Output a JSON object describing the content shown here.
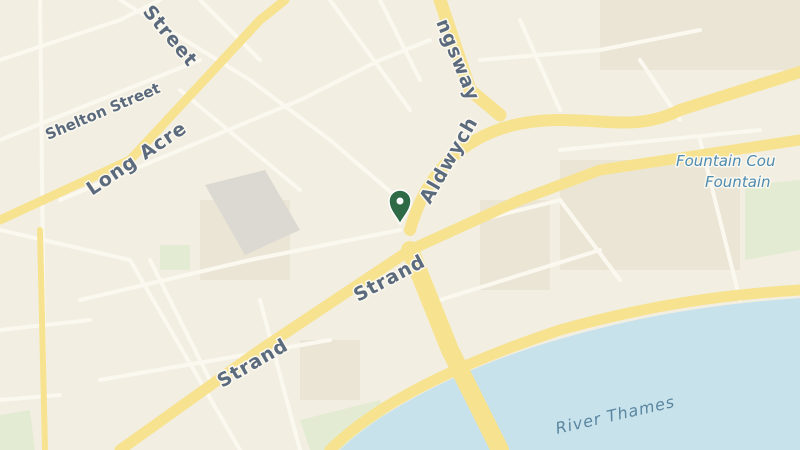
{
  "map": {
    "labels": {
      "shelton_street": "Shelton Street",
      "long_acre": "Long Acre",
      "street_fragment": "Street",
      "kingsway": "ngsway",
      "aldwych": "Aldwych",
      "strand_upper": "Strand",
      "strand_lower": "Strand",
      "fountain_court": "Fountain Cou",
      "fountain": "Fountain",
      "river_thames": "River Thames"
    },
    "marker": {
      "icon": "map-pin-icon",
      "color": "#2d6a45"
    },
    "colors": {
      "land": "#f2eee2",
      "major_road": "#f7e38f",
      "minor_road": "#fbf8f0",
      "water": "#c8e2ec",
      "park": "#e3ecd2"
    }
  }
}
